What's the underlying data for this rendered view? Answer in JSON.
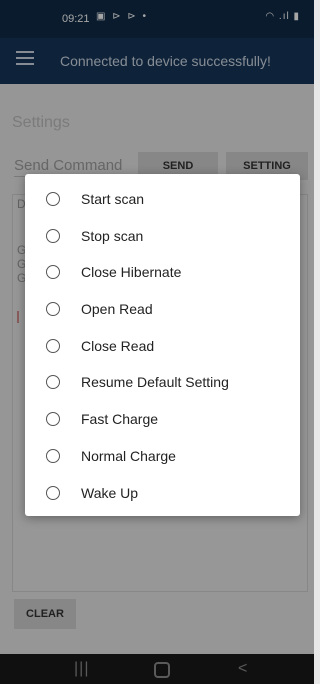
{
  "status_bar": {
    "time": "09:21",
    "left_icons": "▣ ⊳ ⊳ •",
    "right_icons": "◠ .ıl ▮"
  },
  "app_bar": {
    "menu_icon": "hamburger-icon",
    "title": "Connected to device successfully!"
  },
  "main": {
    "settings_label": "Settings",
    "send_command_placeholder": "Send Command",
    "send_button": "SEND",
    "setting_button": "SETTING",
    "log_fragments": [
      "D",
      "G",
      "G",
      "G"
    ],
    "clear_button": "CLEAR"
  },
  "dialog": {
    "options": [
      "Start scan",
      "Stop scan",
      "Close Hibernate",
      "Open Read",
      "Close Read",
      "Resume Default Setting",
      "Fast Charge",
      "Normal Charge",
      "Wake Up"
    ]
  },
  "nav_bar": {
    "recents": "|||",
    "back": "<"
  }
}
